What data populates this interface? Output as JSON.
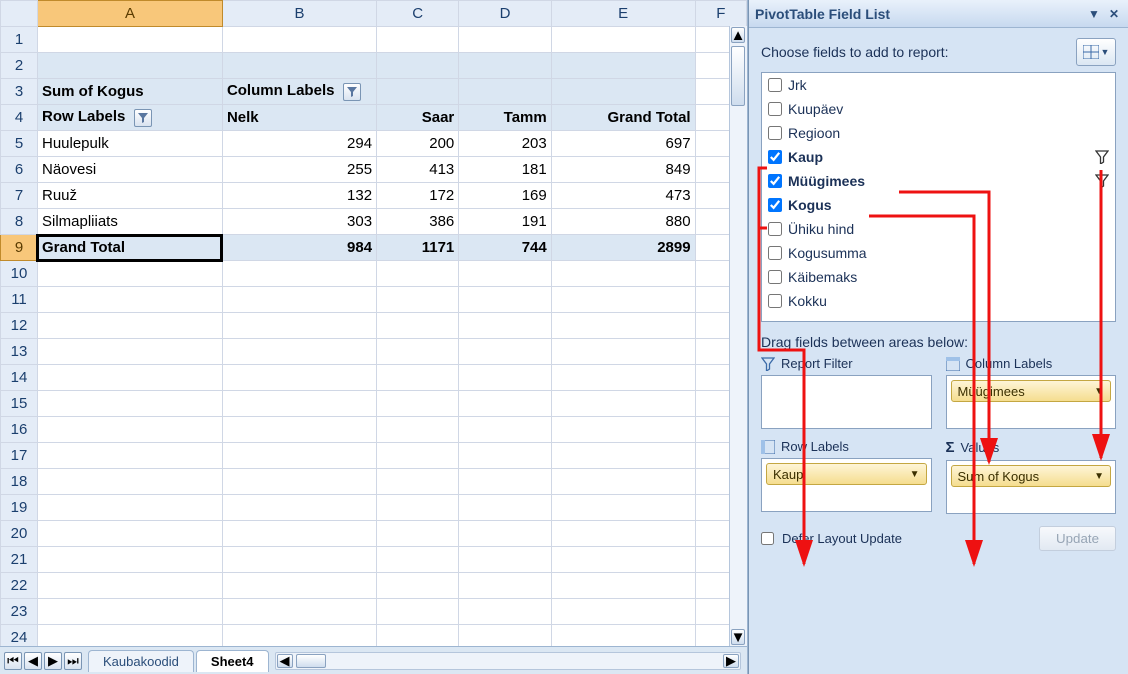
{
  "pivot": {
    "value_field_label": "Sum of Kogus",
    "column_labels_label": "Column Labels",
    "row_labels_label": "Row Labels",
    "column_headers": [
      "Nelk",
      "Saar",
      "Tamm",
      "Grand Total"
    ],
    "rows": [
      {
        "label": "Huulepulk",
        "values": [
          294,
          200,
          203,
          697
        ]
      },
      {
        "label": "Näovesi",
        "values": [
          255,
          413,
          181,
          849
        ]
      },
      {
        "label": "Ruuž",
        "values": [
          132,
          172,
          169,
          473
        ]
      },
      {
        "label": "Silmapliiats",
        "values": [
          303,
          386,
          191,
          880
        ]
      }
    ],
    "grand_total_label": "Grand Total",
    "grand_totals": [
      984,
      1171,
      744,
      2899
    ]
  },
  "columns": [
    "A",
    "B",
    "C",
    "D",
    "E",
    "F"
  ],
  "visible_row_count": 24,
  "selected_cell": {
    "col": "A",
    "row": 9
  },
  "tabs": {
    "items": [
      "Kaubakoodid",
      "Sheet4"
    ],
    "active_index": 1
  },
  "field_pane": {
    "title": "PivotTable Field List",
    "choose_label": "Choose fields to add to report:",
    "fields": [
      {
        "name": "Jrk",
        "checked": false,
        "bold": false,
        "filtered": false
      },
      {
        "name": "Kuupäev",
        "checked": false,
        "bold": false,
        "filtered": false
      },
      {
        "name": "Regioon",
        "checked": false,
        "bold": false,
        "filtered": false
      },
      {
        "name": "Kaup",
        "checked": true,
        "bold": true,
        "filtered": true
      },
      {
        "name": "Müügimees",
        "checked": true,
        "bold": true,
        "filtered": true
      },
      {
        "name": "Kogus",
        "checked": true,
        "bold": true,
        "filtered": false
      },
      {
        "name": "Ühiku hind",
        "checked": false,
        "bold": false,
        "filtered": false
      },
      {
        "name": "Kogusumma",
        "checked": false,
        "bold": false,
        "filtered": false
      },
      {
        "name": "Käibemaks",
        "checked": false,
        "bold": false,
        "filtered": false
      },
      {
        "name": "Kokku",
        "checked": false,
        "bold": false,
        "filtered": false
      }
    ],
    "areas_label": "Drag fields between areas below:",
    "areas": {
      "report_filter": {
        "title": "Report Filter",
        "items": []
      },
      "column_labels": {
        "title": "Column Labels",
        "items": [
          "Müügimees"
        ]
      },
      "row_labels": {
        "title": "Row Labels",
        "items": [
          "Kaup"
        ]
      },
      "values": {
        "title": "Values",
        "items": [
          "Sum of Kogus"
        ]
      }
    },
    "defer_label": "Defer Layout Update",
    "update_label": "Update"
  },
  "chart_data": {
    "type": "table",
    "title": "Sum of Kogus by Kaup × Müügimees",
    "row_field": "Kaup",
    "column_field": "Müügimees",
    "value_field": "Sum of Kogus",
    "columns": [
      "Nelk",
      "Saar",
      "Tamm"
    ],
    "rows": [
      "Huulepulk",
      "Näovesi",
      "Ruuž",
      "Silmapliiats"
    ],
    "values": [
      [
        294,
        200,
        203
      ],
      [
        255,
        413,
        181
      ],
      [
        132,
        172,
        169
      ],
      [
        303,
        386,
        191
      ]
    ],
    "row_totals": [
      697,
      849,
      473,
      880
    ],
    "column_totals": [
      984,
      1171,
      744
    ],
    "grand_total": 2899
  }
}
